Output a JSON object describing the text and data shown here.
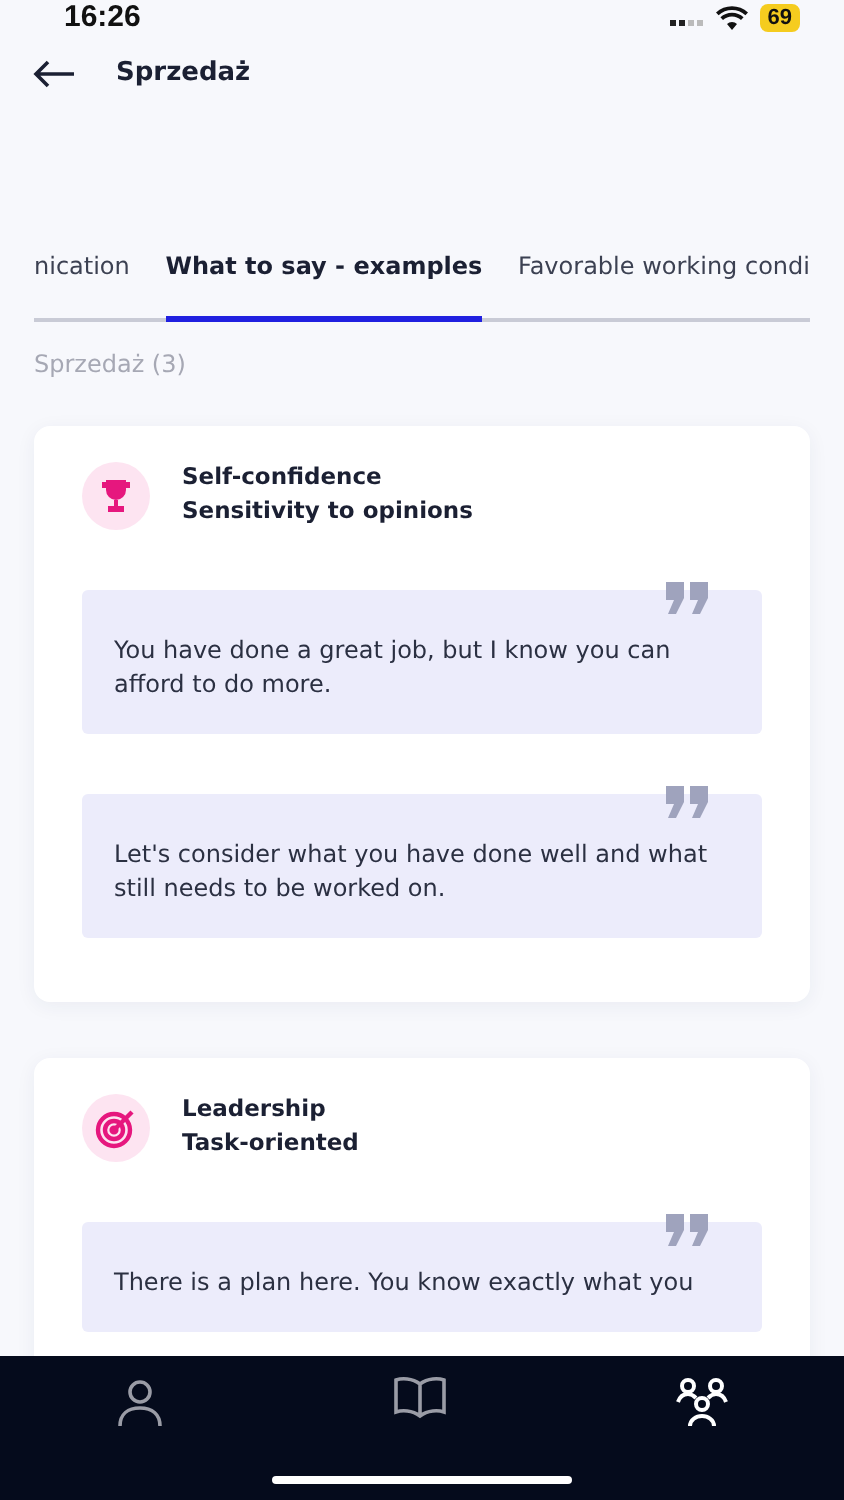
{
  "status_bar": {
    "time": "16:26",
    "battery": "69"
  },
  "header": {
    "title": "Sprzedaż"
  },
  "tabs": [
    {
      "label": "nication",
      "selected": false
    },
    {
      "label": "What to say - examples",
      "selected": true
    },
    {
      "label": "Favorable working condi",
      "selected": false
    }
  ],
  "section": {
    "title": "Sprzedaż (3)"
  },
  "cards": [
    {
      "kind": "trophy",
      "title": "Self-confidence",
      "subtitle": "Sensitivity to opinions",
      "quotes": [
        "You have done a great job, but I know you can afford to do more.",
        "Let's consider what you have done well and what still needs to be worked on."
      ]
    },
    {
      "kind": "target",
      "title": "Leadership",
      "subtitle": "Task-oriented",
      "quotes": [
        "There is a plan here. You know exactly what you"
      ]
    }
  ],
  "nav": [
    {
      "kind": "person",
      "selected": false
    },
    {
      "kind": "book",
      "selected": false
    },
    {
      "kind": "team",
      "selected": true
    }
  ]
}
